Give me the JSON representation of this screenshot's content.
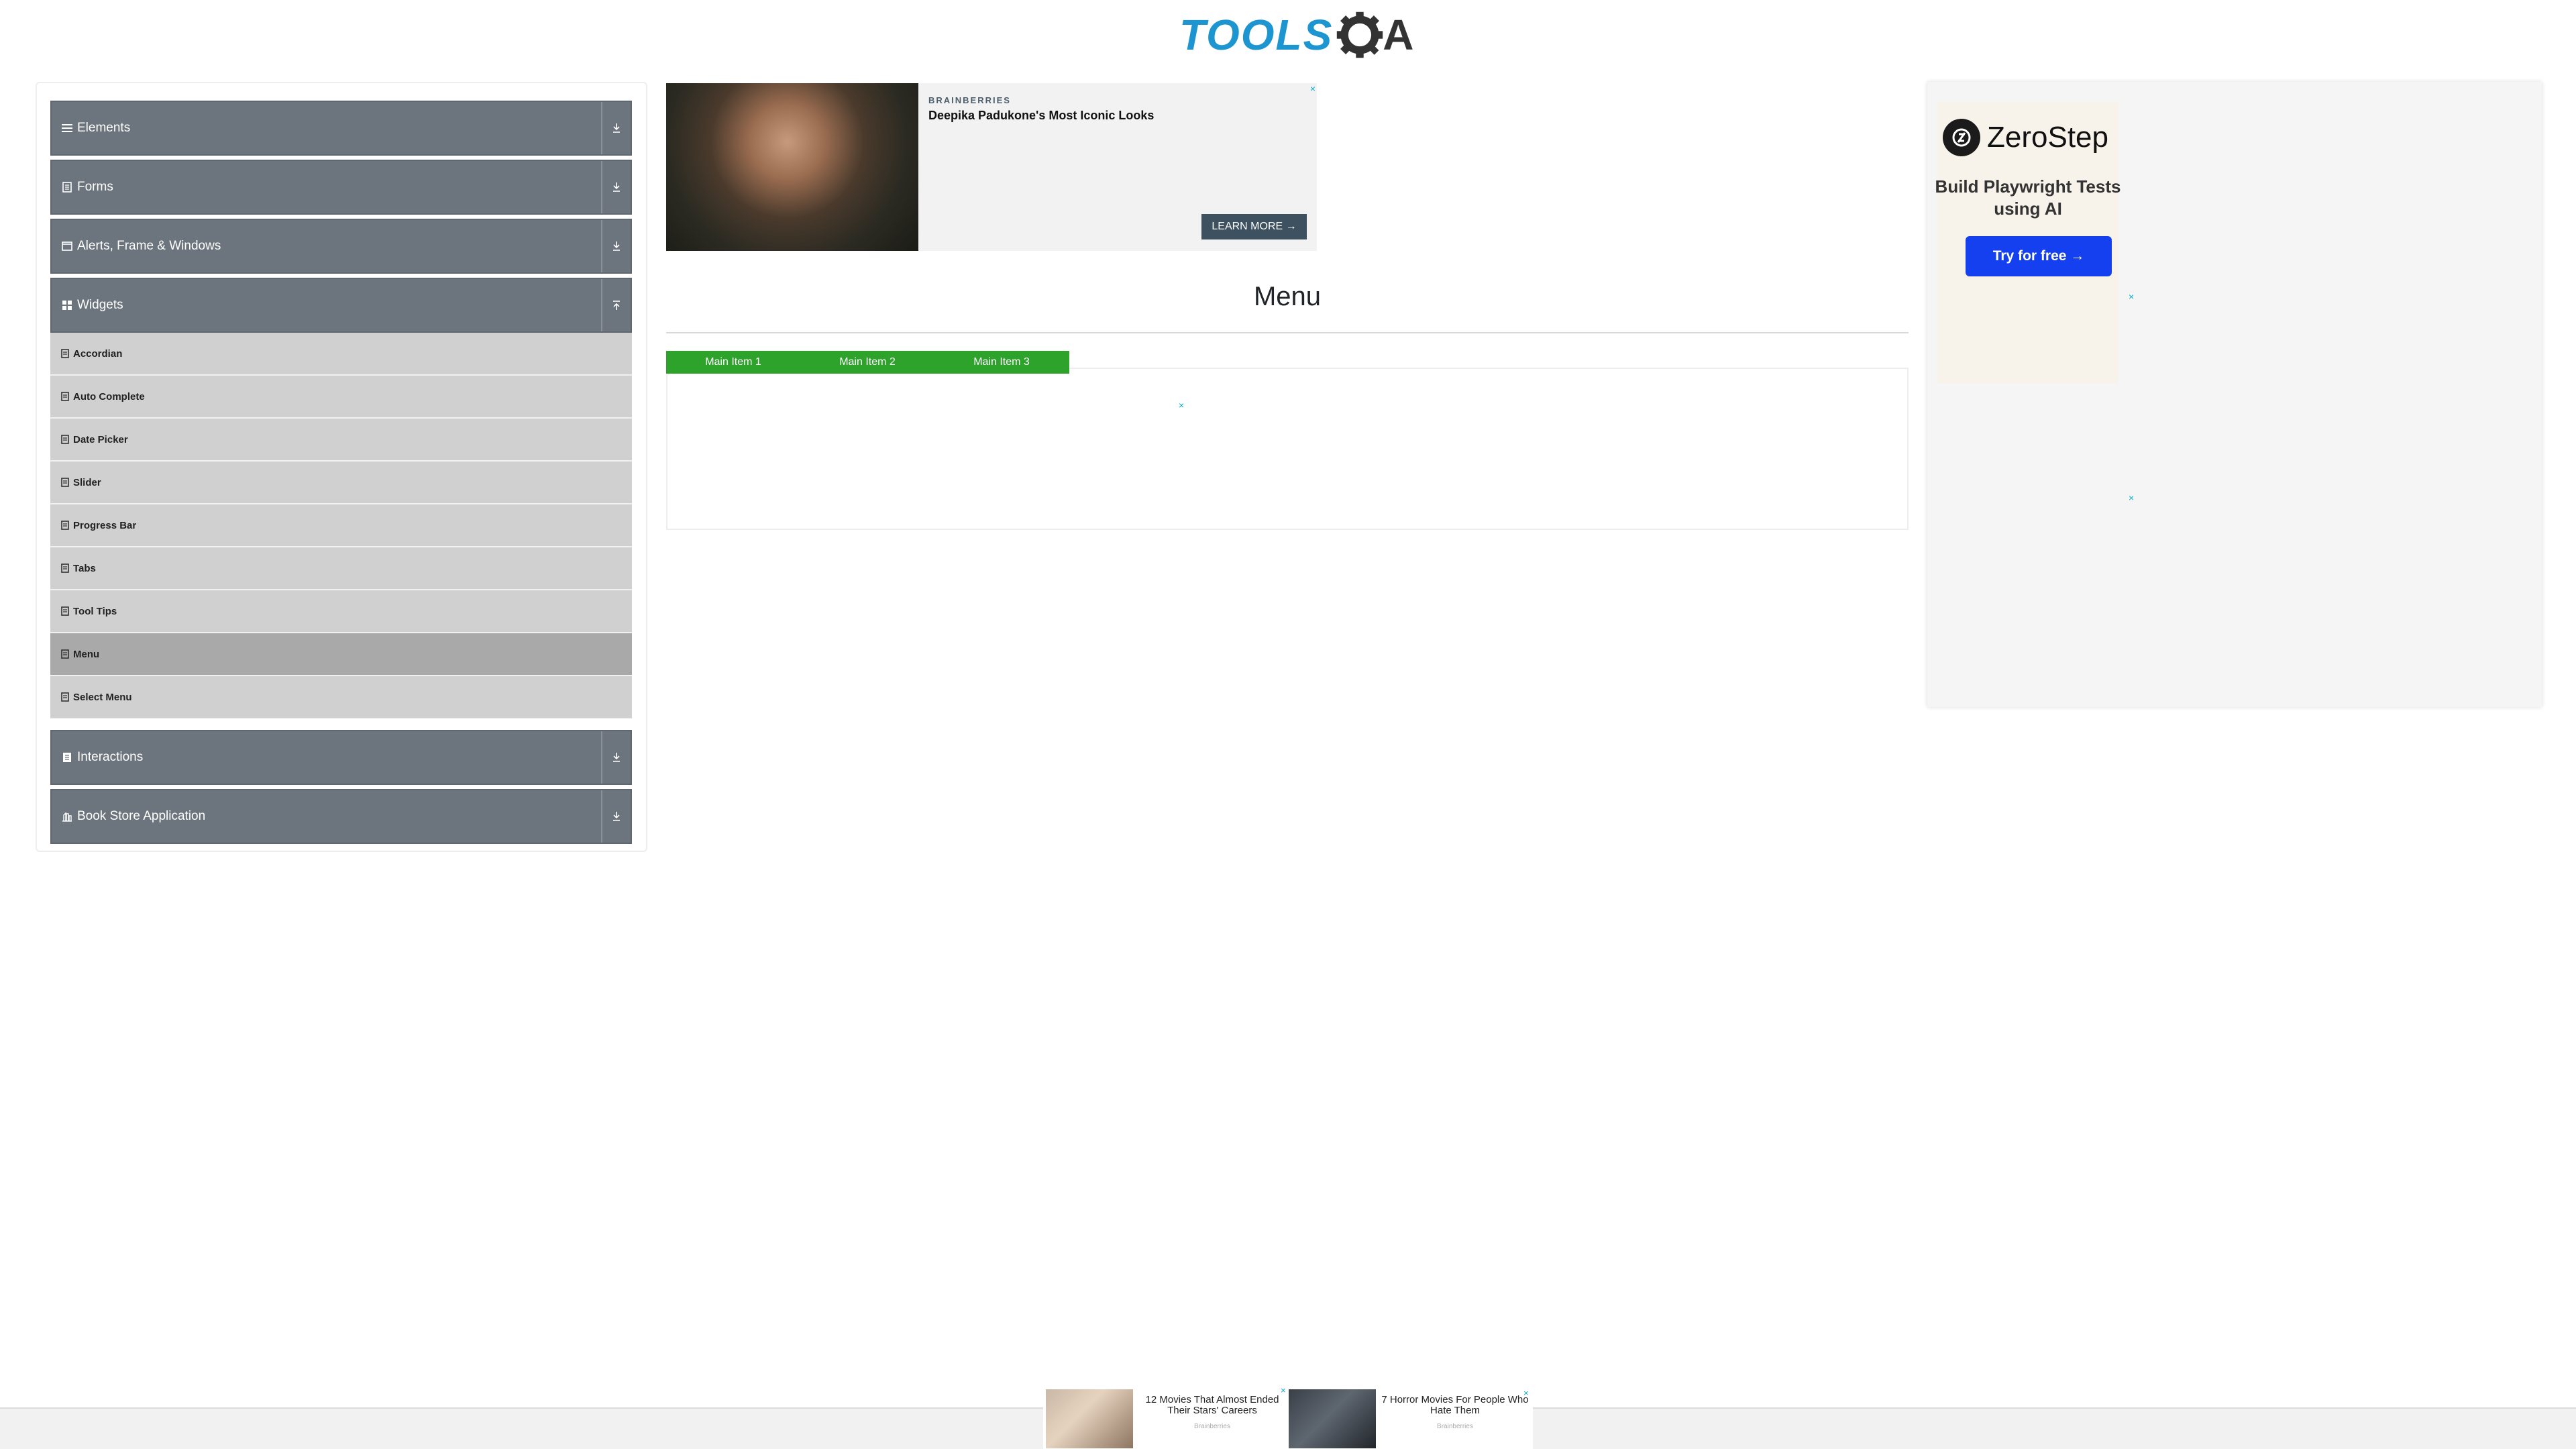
{
  "header": {
    "logo_text": "TOOLS",
    "logo_suffix": "A",
    "gear_icon": "gear-icon"
  },
  "sidebar": {
    "groups": [
      {
        "label": "Elements",
        "icon": "menu-lines-icon",
        "expanded": false
      },
      {
        "label": "Forms",
        "icon": "form-icon",
        "expanded": false
      },
      {
        "label": "Alerts, Frame & Windows",
        "icon": "window-icon",
        "expanded": false
      },
      {
        "label": "Widgets",
        "icon": "widgets-grid-icon",
        "expanded": true
      },
      {
        "label": "Interactions",
        "icon": "interactions-icon",
        "expanded": false
      },
      {
        "label": "Book Store Application",
        "icon": "bookstore-icon",
        "expanded": false
      }
    ],
    "widget_items": [
      {
        "label": "Accordian",
        "active": false
      },
      {
        "label": "Auto Complete",
        "active": false
      },
      {
        "label": "Date Picker",
        "active": false
      },
      {
        "label": "Slider",
        "active": false
      },
      {
        "label": "Progress Bar",
        "active": false
      },
      {
        "label": "Tabs",
        "active": false
      },
      {
        "label": "Tool Tips",
        "active": false
      },
      {
        "label": "Menu",
        "active": true
      },
      {
        "label": "Select Menu",
        "active": false
      }
    ]
  },
  "ad_top": {
    "brand": "BRAINBERRIES",
    "title": "Deepika Padukone's Most Iconic Looks",
    "cta": "LEARN MORE →",
    "close": "×"
  },
  "main": {
    "title": "Menu",
    "nav": [
      "Main Item 1",
      "Main Item 2",
      "Main Item 3"
    ],
    "nav_color": "#2ea32c",
    "close": "×"
  },
  "ad_right": {
    "brand": "ZeroStep",
    "tagline": "Build Playwright Tests using AI",
    "cta": "Try for free →",
    "cta_color": "#1440f0",
    "close": "×"
  },
  "footer_ad": {
    "items": [
      {
        "title": "12 Movies That Almost Ended Their Stars' Careers",
        "source": "Brainberries"
      },
      {
        "title": "7 Horror Movies For People Who Hate Them",
        "source": "Brainberries"
      }
    ],
    "close": "×"
  }
}
